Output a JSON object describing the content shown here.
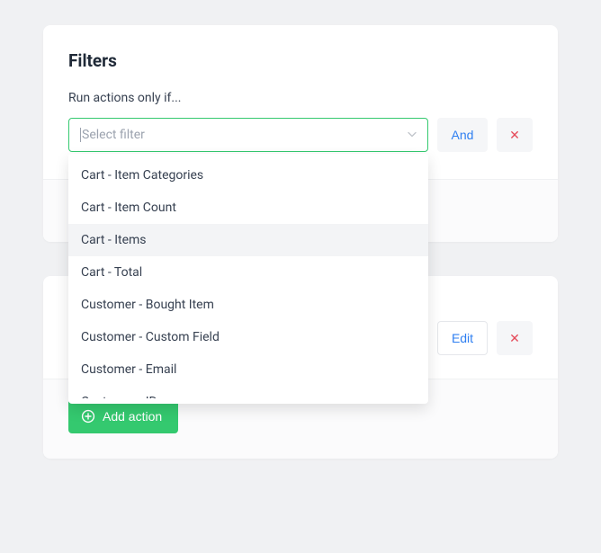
{
  "filters": {
    "title": "Filters",
    "subtitle": "Run actions only if...",
    "select_placeholder": "Select filter",
    "dropdown": {
      "items": [
        {
          "label": "Cart - Item Categories"
        },
        {
          "label": "Cart - Item Count"
        },
        {
          "label": "Cart - Items"
        },
        {
          "label": "Cart - Total"
        },
        {
          "label": "Customer - Bought Item"
        },
        {
          "label": "Customer - Custom Field"
        },
        {
          "label": "Customer - Email"
        },
        {
          "label": "Customer - ID"
        }
      ],
      "highlighted_index": 2
    },
    "and_label": "And",
    "remove_symbol": "✕"
  },
  "actions": {
    "edit_label": "Edit",
    "remove_symbol": "✕",
    "add_action_label": "Add action"
  }
}
